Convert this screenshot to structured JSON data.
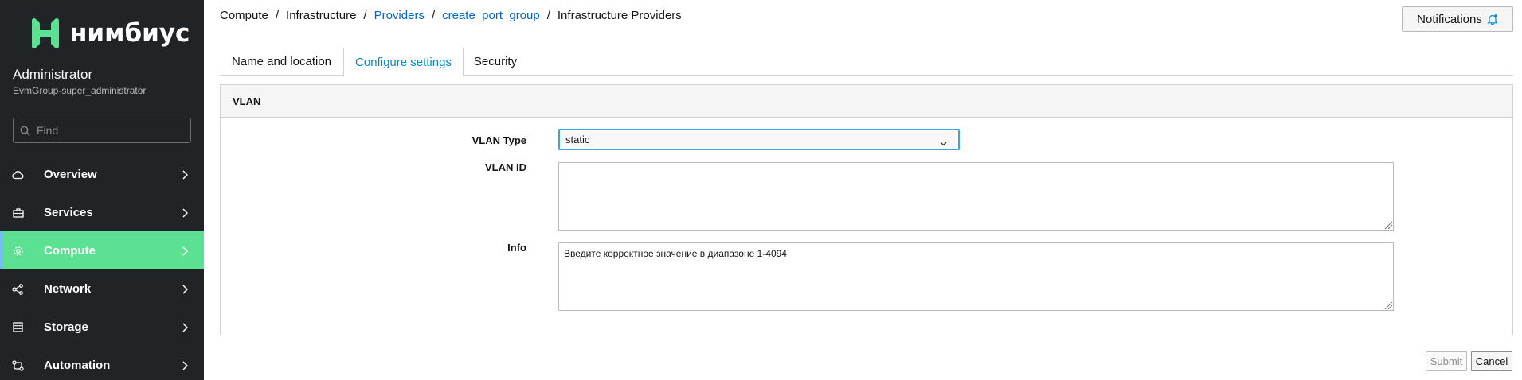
{
  "brand": {
    "name": "нимбиус",
    "accent": "#5ce092"
  },
  "user": {
    "name": "Administrator",
    "group": "EvmGroup-super_administrator"
  },
  "search": {
    "placeholder": "Find",
    "value": ""
  },
  "nav": [
    {
      "label": "Overview",
      "icon": "cloud-icon",
      "active": false
    },
    {
      "label": "Services",
      "icon": "briefcase-icon",
      "active": false
    },
    {
      "label": "Compute",
      "icon": "gear-icon",
      "active": true
    },
    {
      "label": "Network",
      "icon": "network-icon",
      "active": false
    },
    {
      "label": "Storage",
      "icon": "database-icon",
      "active": false
    },
    {
      "label": "Automation",
      "icon": "automation-icon",
      "active": false
    }
  ],
  "breadcrumb": [
    "Compute",
    "Infrastructure",
    "Providers",
    "create_port_group",
    "Infrastructure Providers"
  ],
  "notifications": {
    "label": "Notifications",
    "icon": "bell-icon"
  },
  "tabs": [
    {
      "label": "Name and location",
      "active": false
    },
    {
      "label": "Configure settings",
      "active": true
    },
    {
      "label": "Security",
      "active": false
    }
  ],
  "section": {
    "title": "VLAN"
  },
  "form": {
    "vlan_type": {
      "label": "VLAN Type",
      "value": "static"
    },
    "vlan_id": {
      "label": "VLAN ID",
      "value": ""
    },
    "info": {
      "label": "Info",
      "value": "Введите корректное значение в диапазоне 1-4094"
    }
  },
  "buttons": {
    "submit": "Submit",
    "cancel": "Cancel"
  }
}
